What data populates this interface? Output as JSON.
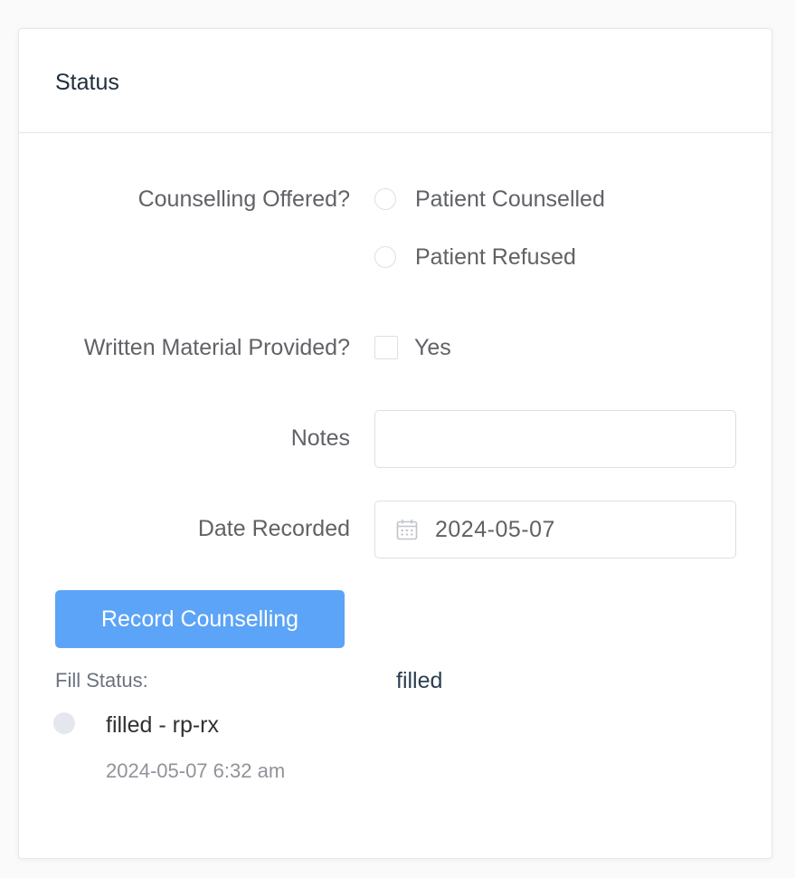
{
  "card": {
    "title": "Status"
  },
  "form": {
    "counselling": {
      "label": "Counselling Offered?",
      "options": [
        {
          "label": "Patient Counselled",
          "selected": false
        },
        {
          "label": "Patient Refused",
          "selected": false
        }
      ]
    },
    "written_material": {
      "label": "Written Material Provided?",
      "option_label": "Yes",
      "checked": false
    },
    "notes": {
      "label": "Notes",
      "value": ""
    },
    "date_recorded": {
      "label": "Date Recorded",
      "value": "2024-05-07",
      "icon": "calendar-icon"
    },
    "submit_label": "Record Counselling"
  },
  "fill_status": {
    "label": "Fill Status:",
    "value": "filled"
  },
  "timeline": [
    {
      "content": "filled - rp-rx",
      "timestamp": "2024-05-07 6:32 am"
    }
  ],
  "colors": {
    "primary_button": "#5ba4f7",
    "border": "#dcdfe6",
    "timeline_dot": "#e4e7ed"
  }
}
